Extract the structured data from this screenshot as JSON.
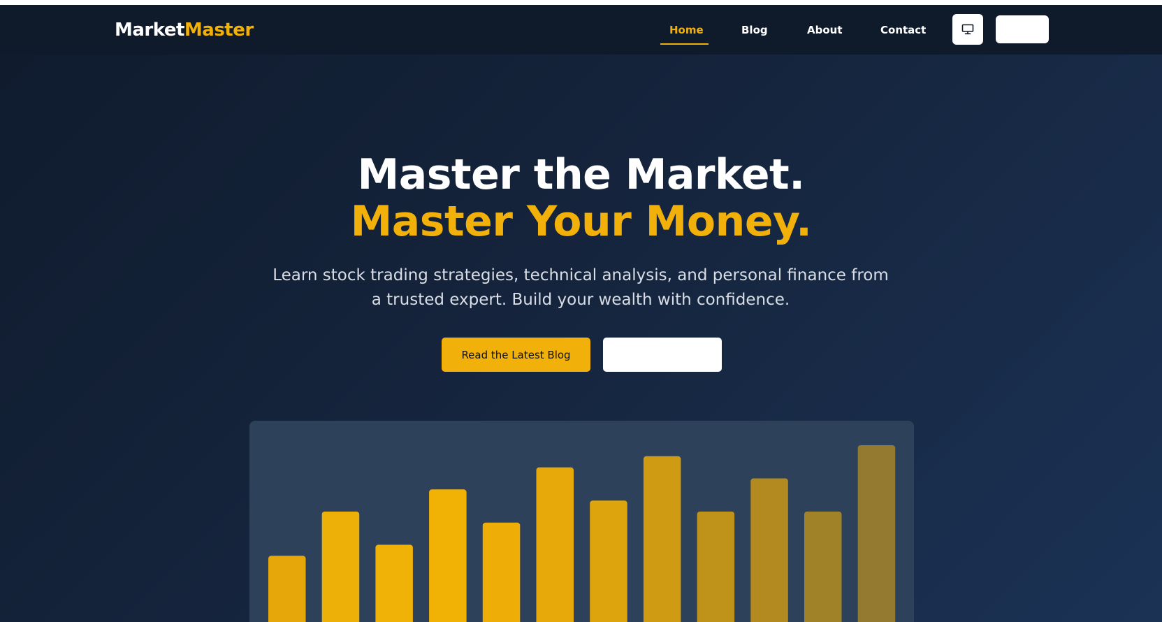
{
  "logo": {
    "part1": "Market",
    "part2": "Master"
  },
  "nav": {
    "items": [
      {
        "label": "Home",
        "active": true
      },
      {
        "label": "Blog"
      },
      {
        "label": "About"
      },
      {
        "label": "Contact"
      }
    ],
    "theme_icon": "monitor-icon"
  },
  "hero": {
    "title_line1": "Master the Market.",
    "title_line2": "Master Your Money.",
    "subtitle": "Learn stock trading strategies, technical analysis, and personal finance from a trusted expert. Build your wealth with confidence.",
    "primary_button": "Read the Latest Blog"
  },
  "colors": {
    "accent": "#f2b10a",
    "nav_bg": "#0f1a2b",
    "card_bg": "#2e415b"
  },
  "chart_data": {
    "type": "bar",
    "values": [
      40,
      60,
      45,
      70,
      55,
      80,
      65,
      85,
      60,
      75,
      60,
      90
    ],
    "colors": [
      "#e6a70b",
      "#edb008",
      "#f0b206",
      "#f2b205",
      "#eeae07",
      "#e7a90a",
      "#dea40d",
      "#cf9b12",
      "#bf9219",
      "#b38a20",
      "#a08229",
      "#947a30"
    ]
  }
}
